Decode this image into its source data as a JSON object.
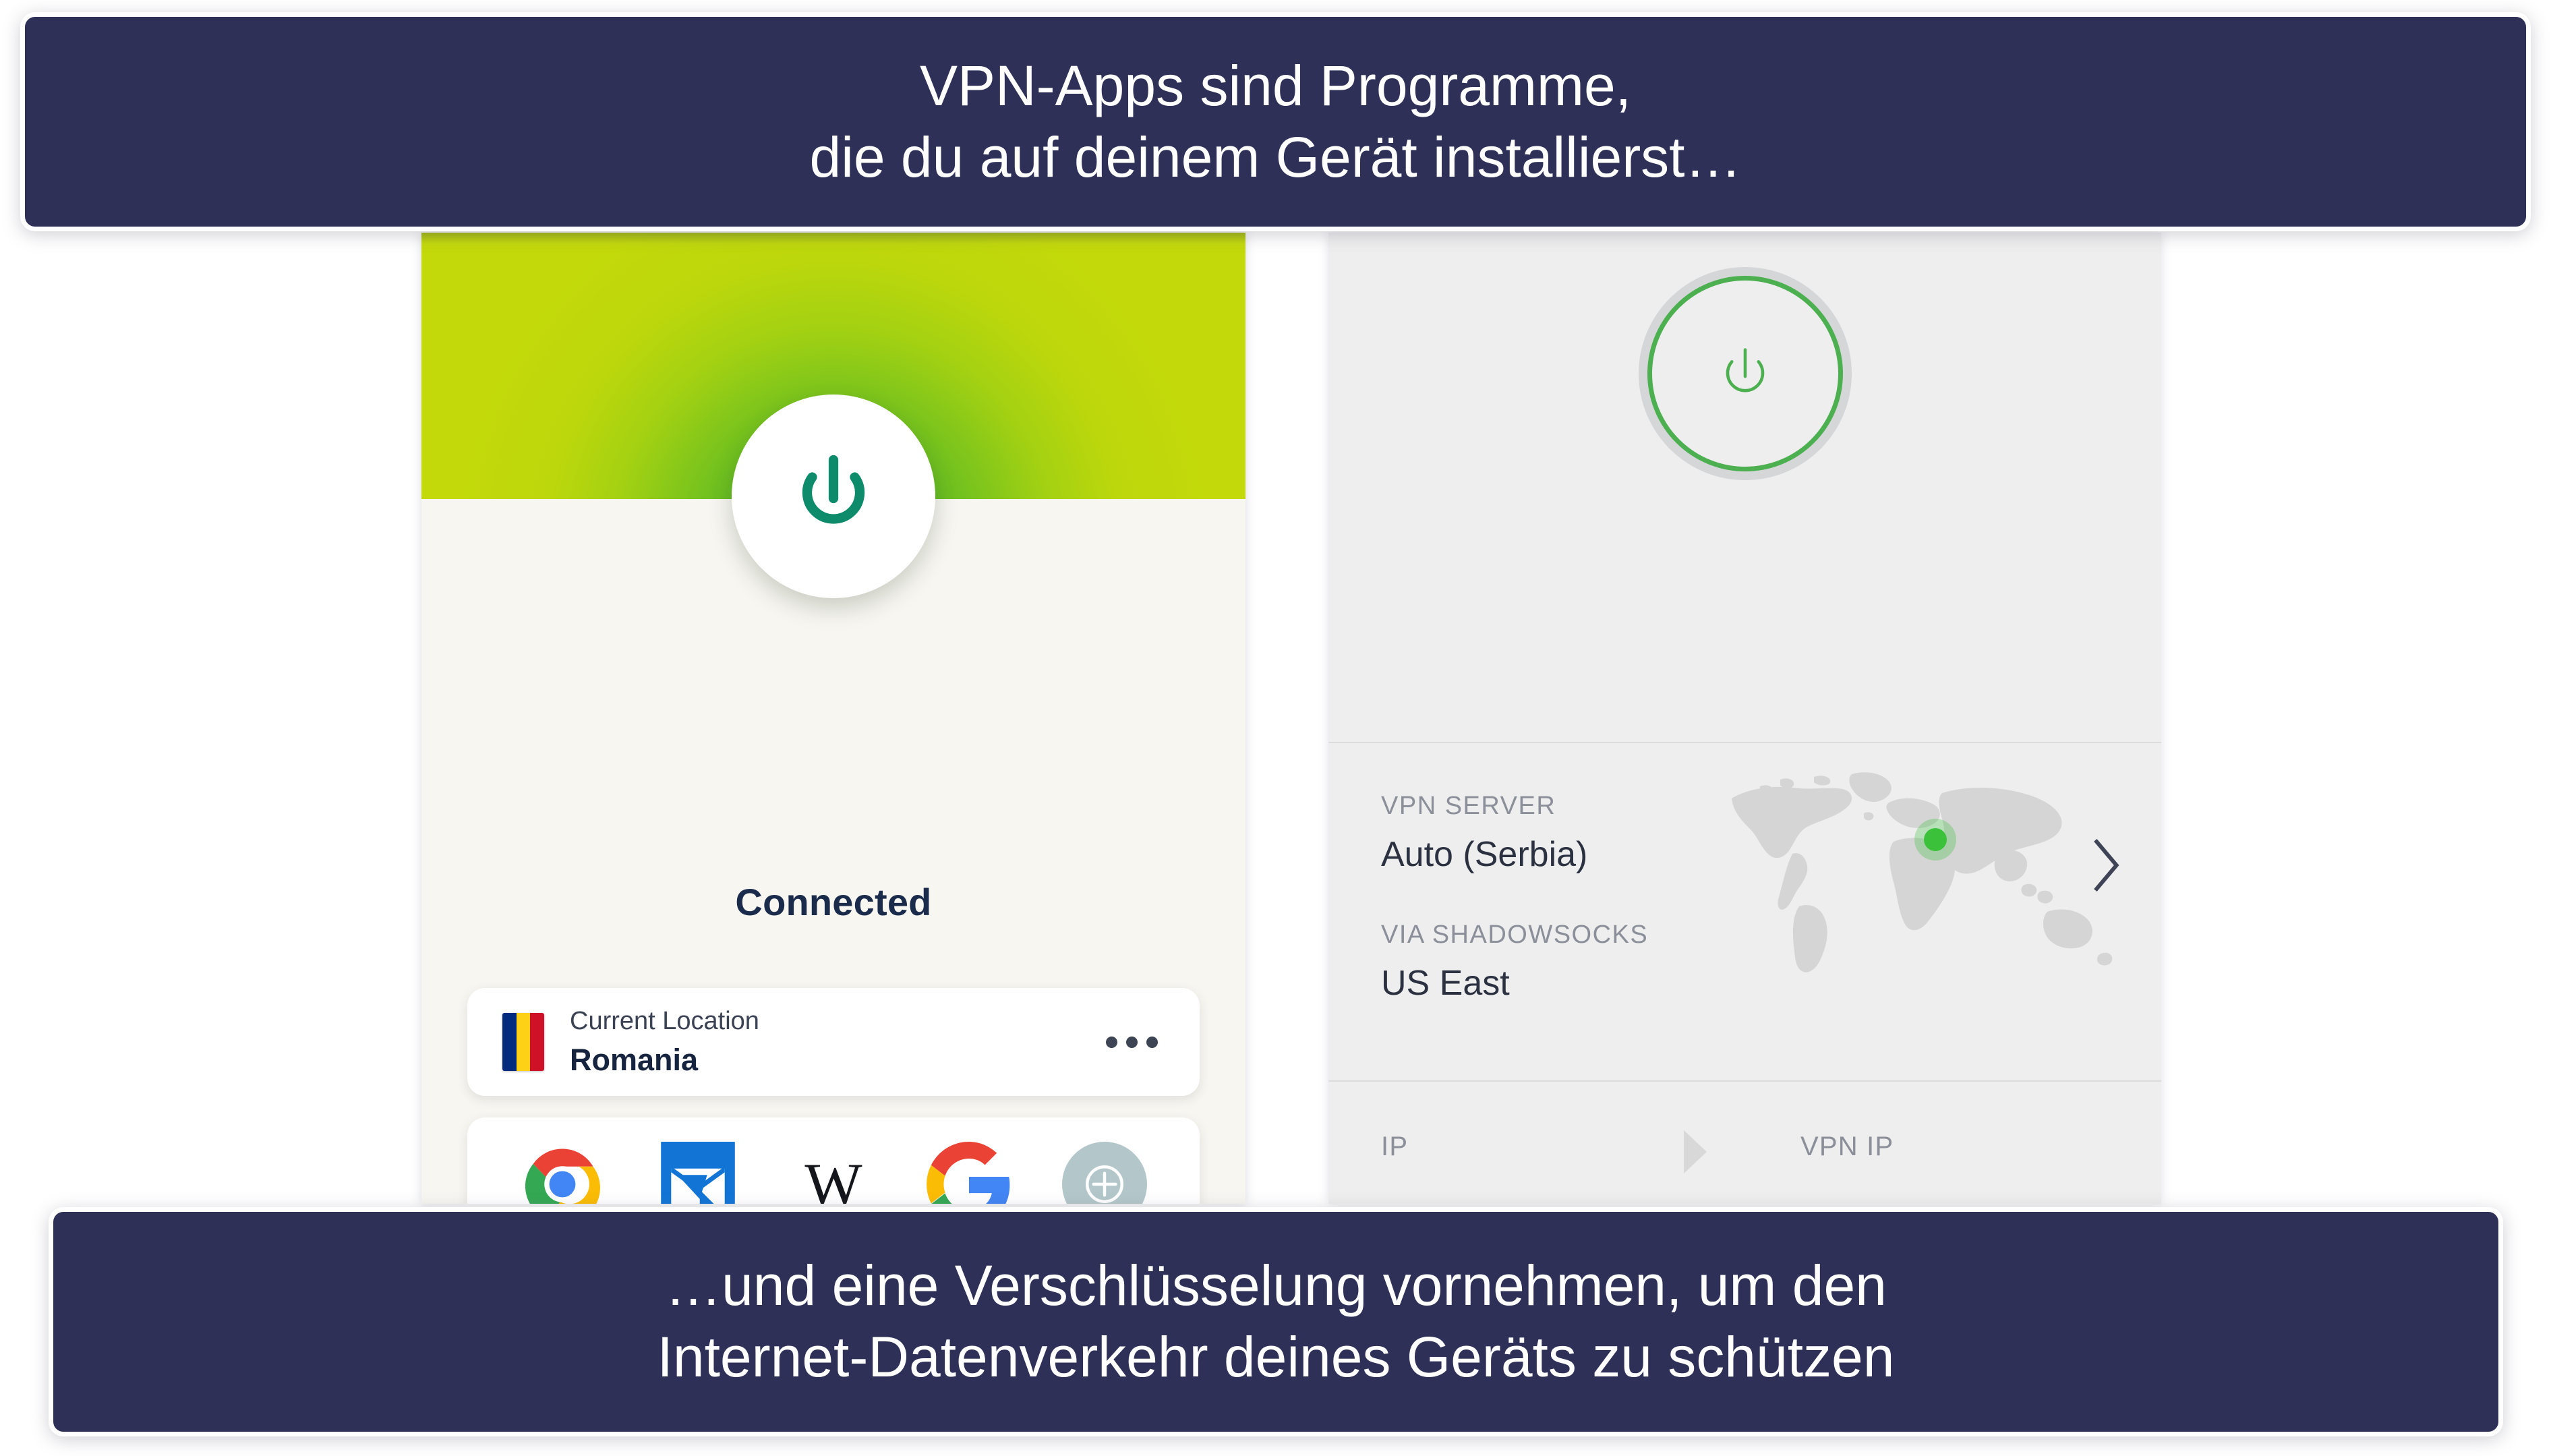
{
  "captions": {
    "top": {
      "line1": "VPN-Apps sind Programme,",
      "line2": "die du auf deinem Gerät installierst…"
    },
    "bottom": {
      "line1": "…und eine Verschlüsselung vornehmen, um den",
      "line2": "Internet-Datenverkehr deines Geräts zu schützen"
    },
    "background_color": "#2e3057",
    "text_color": "#ffffff"
  },
  "left_app": {
    "status_label": "Connected",
    "power_button": {
      "icon": "power-icon",
      "state": "on",
      "icon_color": "#0d8b6a",
      "background_color": "#ffffff"
    },
    "hero": {
      "gradient_from": "#2faa3c",
      "gradient_to": "#c3d90a"
    },
    "location_card": {
      "caption": "Current Location",
      "name": "Romania",
      "flag": "romania-flag",
      "flag_colors": [
        "#002b7f",
        "#fcd116",
        "#ce1126"
      ],
      "menu_icon": "more-options-icon"
    },
    "shortcuts": [
      {
        "name": "chrome-shortcut",
        "icon": "chrome-icon"
      },
      {
        "name": "mail-shortcut",
        "icon": "mail-icon"
      },
      {
        "name": "wikipedia-shortcut",
        "icon": "wikipedia-icon"
      },
      {
        "name": "google-shortcut",
        "icon": "google-icon"
      },
      {
        "name": "add-shortcut",
        "icon": "plus-circle-icon"
      }
    ],
    "surface_color": "#f7f6f1"
  },
  "right_app": {
    "power_button": {
      "icon": "power-icon",
      "state": "on",
      "ring_color": "#4caf50",
      "halo_color": "#c3c6c8"
    },
    "server": {
      "caption": "VPN SERVER",
      "value": "Auto (Serbia)",
      "proxy_caption": "VIA SHADOWSOCKS",
      "proxy_value": "US East",
      "map_icon": "world-map-icon",
      "map_marker_color": "#3cc13b",
      "chevron_icon": "chevron-right-icon"
    },
    "ip_row": {
      "ip_label": "IP",
      "vpn_ip_label": "VPN IP",
      "arrow_icon": "arrow-right-icon"
    },
    "surface_color": "#eeeeee"
  }
}
